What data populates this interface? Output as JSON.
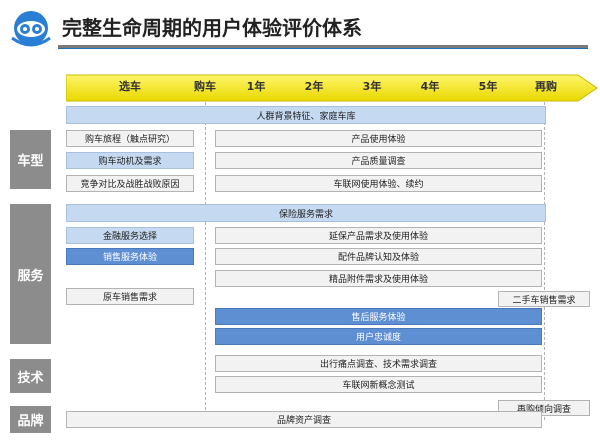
{
  "header": {
    "title": "完整生命周期的用户体验评价体系",
    "logo_icon": "eye-logo-icon"
  },
  "timeline": {
    "ticks": [
      "选车",
      "购车",
      "1年",
      "2年",
      "3年",
      "4年",
      "5年",
      "再购"
    ]
  },
  "categories": {
    "model": "车型",
    "service": "服务",
    "tech": "技术",
    "brand": "品牌"
  },
  "rows": {
    "crowd_background": "人群背景特征、家庭车库",
    "purchase_journey": "购车旅程（触点研究）",
    "purchase_motive": "购车动机及需求",
    "competitor_compare": "竞争对比及战胜战败原因",
    "product_experience": "产品使用体验",
    "quality_survey": "产品质量调查",
    "connected_car_usage": "车联网使用体验、续约",
    "insurance_needs": "保险服务需求",
    "finance_selection": "金融服务选择",
    "sales_experience": "销售服务体验",
    "extended_warranty": "延保产品需求及使用体验",
    "parts_brand": "配件品牌认知及体验",
    "accessories": "精品附件需求及使用体验",
    "oem_used_car": "原车销售需求",
    "second_hand_sales": "二手车销售需求",
    "after_sales": "售后服务体验",
    "loyalty": "用户忠诚度",
    "pain_points": "出行痛点调查、技术需求调查",
    "connected_concept": "车联网新概念测试",
    "repurchase_intent": "再购倾向调查",
    "brand_asset": "品牌资产调查"
  },
  "colors": {
    "category_gray": "#8c8c8c",
    "timeline_yellow": "#f4e400",
    "light_blue": "#c5d9f1",
    "dark_blue": "#5f8fd3",
    "light_gray": "#f2f2f2",
    "accent_blue": "#1c6fb8"
  }
}
